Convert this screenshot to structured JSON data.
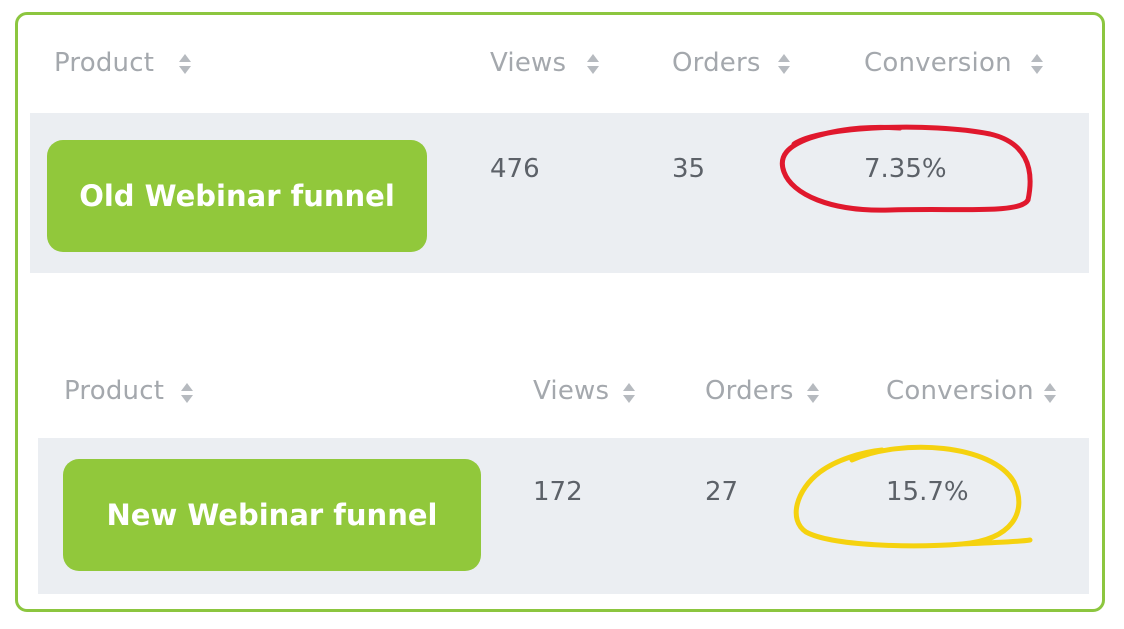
{
  "table_old": {
    "headers": {
      "product": "Product",
      "views": "Views",
      "orders": "Orders",
      "conversion": "Conversion"
    },
    "row": {
      "product": "Old Webinar funnel",
      "views": "476",
      "orders": "35",
      "conversion": "7.35%"
    },
    "highlight_color": "#e0182d"
  },
  "table_new": {
    "headers": {
      "product": "Product",
      "views": "Views",
      "orders": "Orders",
      "conversion": "Conversion"
    },
    "row": {
      "product": "New Webinar funnel",
      "views": "172",
      "orders": "27",
      "conversion": "15.7%"
    },
    "highlight_color": "#f5d20f"
  },
  "colors": {
    "accent_green": "#91c83b",
    "frame_border": "#8cc63f",
    "row_background": "#ebeef2"
  },
  "icons": {
    "sort": "sort-arrows-icon"
  }
}
